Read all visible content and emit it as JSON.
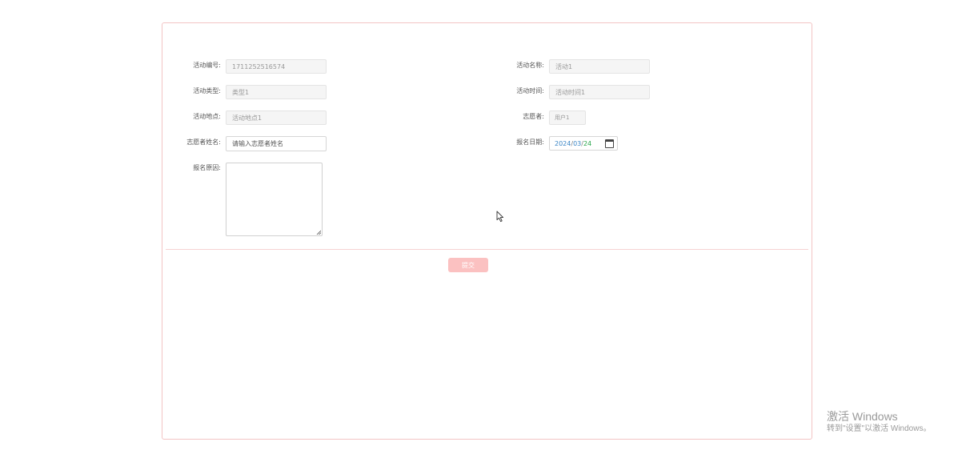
{
  "form": {
    "activity_no": {
      "label": "活动编号:",
      "value": "1711252516574"
    },
    "activity_name": {
      "label": "活动名称:",
      "value": "活动1"
    },
    "activity_type": {
      "label": "活动类型:",
      "value": "类型1"
    },
    "activity_time": {
      "label": "活动时间:",
      "value": "活动时间1"
    },
    "activity_place": {
      "label": "活动地点:",
      "value": "活动地点1"
    },
    "volunteer": {
      "label": "志愿者:",
      "value": "用户1"
    },
    "volunteer_name": {
      "label": "志愿者姓名:",
      "placeholder": "请输入志愿者姓名",
      "value": ""
    },
    "signup_date": {
      "label": "报名日期:",
      "year": "2024",
      "month": "03",
      "day": "24",
      "sep": "/"
    },
    "signup_reason": {
      "label": "报名原因:",
      "value": ""
    }
  },
  "submit_label": "提交",
  "watermark": {
    "title": "激活 Windows",
    "subtitle": "转到\"设置\"以激活 Windows。"
  }
}
